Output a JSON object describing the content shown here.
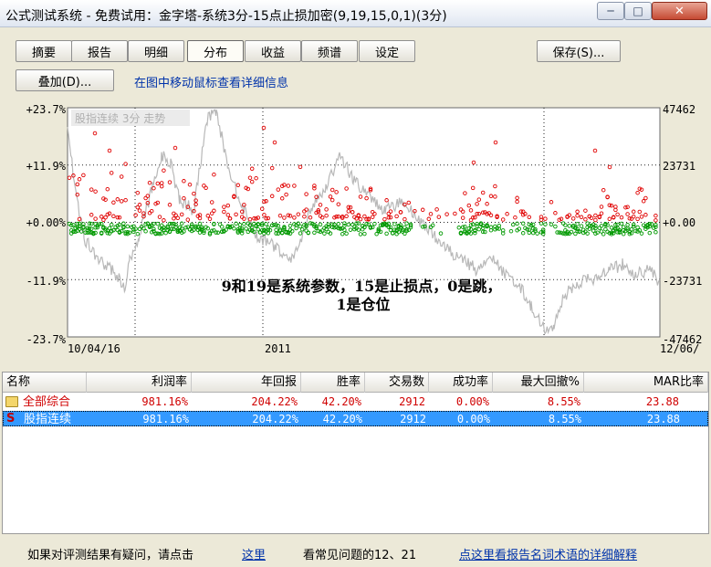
{
  "window": {
    "title": "公式测试系统 - 免费试用：金字塔-系统3分-15点止损加密(9,19,15,0,1)(3分)",
    "min_icon": "minimize-icon",
    "max_icon": "maximize-icon",
    "close_icon": "close-icon"
  },
  "tabs": [
    {
      "label": "摘要"
    },
    {
      "label": "报告"
    },
    {
      "label": "明细"
    },
    {
      "label": "分布",
      "active": true
    },
    {
      "label": "收益"
    },
    {
      "label": "频谱"
    },
    {
      "label": "设定"
    }
  ],
  "buttons": {
    "save": "保存(S)...",
    "overlay": "叠加(D)..."
  },
  "hint": "在图中移动鼠标查看详细信息",
  "chart_data": {
    "type": "scatter",
    "legend_text": "股指连续 3分 走势",
    "left_axis_ticks": [
      "+23.7%",
      "+11.9%",
      "+0.00%",
      "-11.9%",
      "-23.7%"
    ],
    "right_axis_ticks": [
      "47462",
      "23731",
      "+0.00",
      "-23731",
      "-47462"
    ],
    "x_tick_labels": [
      "10/04/16",
      "2011",
      "12/06/"
    ],
    "ylim_left": [
      -23.7,
      23.7
    ],
    "series": [
      {
        "color": "#e00000",
        "marker": "circle-outline"
      },
      {
        "color": "#009900",
        "marker": "circle-outline"
      },
      {
        "color": "#b8b8b8",
        "marker": "line"
      }
    ],
    "annotation_line1": "9和19是系统参数，15是止损点，0是跳，",
    "annotation_line2": "1是仓位",
    "grid": "dotted"
  },
  "table": {
    "columns": [
      "名称",
      "利润率",
      "年回报",
      "胜率",
      "交易数",
      "成功率",
      "最大回撤%",
      "MAR比率"
    ],
    "rows": [
      {
        "icon": "folder-icon",
        "name": "全部综合",
        "values": [
          "981.16%",
          "204.22%",
          "42.20%",
          "2912",
          "0.00%",
          "8.55%",
          "23.88"
        ]
      },
      {
        "icon": "s-icon",
        "icon_text": "S",
        "name": "股指连续",
        "values": [
          "981.16%",
          "204.22%",
          "42.20%",
          "2912",
          "0.00%",
          "8.55%",
          "23.88"
        ],
        "selected": true
      }
    ]
  },
  "footer": {
    "question_text": "如果对评测结果有疑问，请点击",
    "link_here": "这里",
    "faq_text": "看常见问题的12、21",
    "glossary_link": "点这里看报告名词术语的详细解释"
  },
  "colors": {
    "link": "#0033aa",
    "selection": "#3399ff",
    "summary_text": "#d00000"
  }
}
